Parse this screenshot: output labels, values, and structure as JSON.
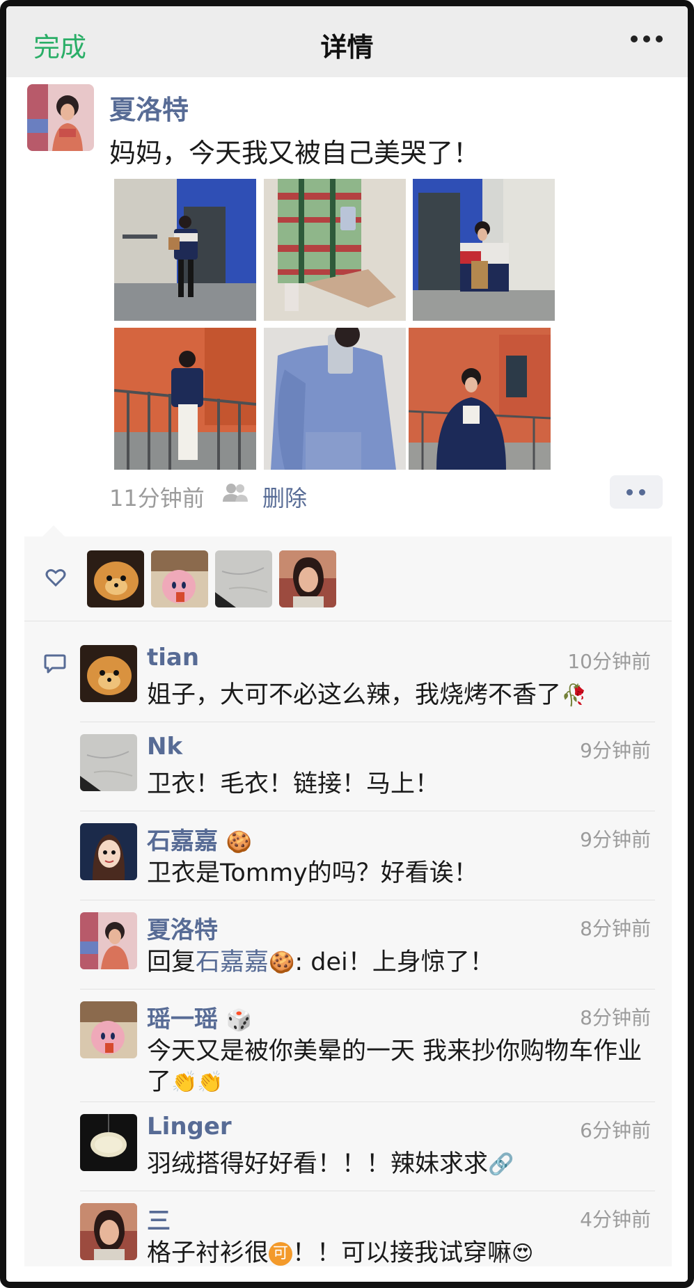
{
  "colors": {
    "accent_green": "#2aae67",
    "link_blue": "#576b95",
    "meta_gray": "#9b9b9b",
    "panel_bg": "#f7f7f7",
    "topbar_bg": "#ededed"
  },
  "topbar": {
    "done_label": "完成",
    "title": "详情",
    "more_icon": "more-dots-icon"
  },
  "post": {
    "author": "夏洛特",
    "text": "妈妈，今天我又被自己美哭了！",
    "photo_count": 6,
    "time": "11分钟前",
    "group_icon": "two-people-icon",
    "delete_label": "删除",
    "action_icon": "two-dots-icon"
  },
  "likes": {
    "icon": "heart-icon",
    "avatars": [
      "pomeranian-dog",
      "kirby-plush",
      "marble-stone",
      "woman-portrait"
    ]
  },
  "comments_icon": "comment-bubble-icon",
  "comments": [
    {
      "name": "tian",
      "time": "10分钟前",
      "text": "姐子，大可不必这么辣，我烧烤不香了",
      "emoji": "🥀",
      "avatar": "pomeranian-dog"
    },
    {
      "name": "Nk",
      "time": "9分钟前",
      "text": "卫衣！毛衣！链接！马上！",
      "avatar": "marble-stone"
    },
    {
      "name": "石嘉嘉",
      "name_emoji": "🍪",
      "time": "9分钟前",
      "text": "卫衣是Tommy的吗？好看诶！",
      "avatar": "cartoon-girl"
    },
    {
      "name": "夏洛特",
      "time": "8分钟前",
      "reply_prefix": "回复",
      "reply_to": "石嘉嘉",
      "reply_emoji": "🍪",
      "text": ": dei！上身惊了！",
      "avatar": "post-author"
    },
    {
      "name": "瑶一瑶",
      "name_emoji": "🎲",
      "time": "8分钟前",
      "text": "今天又是被你美晕的一天 我来抄你购物车作业了",
      "emoji": "👏👏",
      "avatar": "kirby-plush"
    },
    {
      "name": "Linger",
      "time": "6分钟前",
      "text": "羽绒搭得好好看！！！辣妹求求",
      "emoji": "🔗",
      "avatar": "lemon"
    },
    {
      "name": "三",
      "time": "4分钟前",
      "text": "格子衬衫很",
      "badge": "可",
      "text_after": "！！可以接我试穿嘛",
      "emoji": "😍",
      "avatar": "woman-portrait"
    }
  ]
}
